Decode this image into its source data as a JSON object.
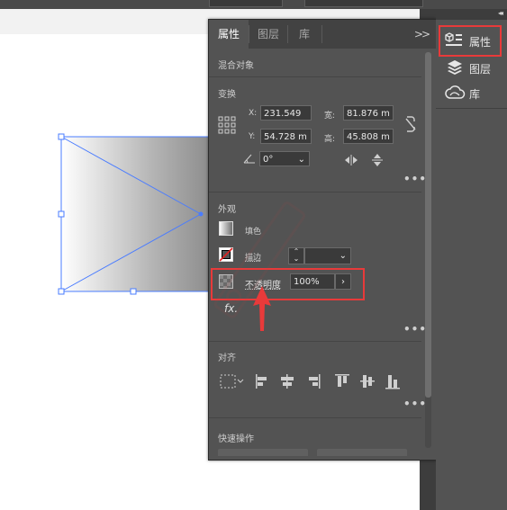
{
  "panel": {
    "tabs": [
      "属性",
      "图层",
      "库"
    ],
    "active_tab": "属性",
    "object_type": "混合对象",
    "transform": {
      "title": "变换",
      "x_label": "X:",
      "x_value": "231.549",
      "y_label": "Y:",
      "y_value": "54.728 m",
      "w_label": "宽:",
      "w_value": "81.876 m",
      "h_label": "高:",
      "h_value": "45.808 m",
      "angle_value": "0°"
    },
    "appearance": {
      "title": "外观",
      "fill_label": "填色",
      "stroke_label": "描边",
      "opacity_label": "不透明度",
      "opacity_value": "100%",
      "fx_label": "fx."
    },
    "align": {
      "title": "对齐"
    },
    "quick_actions": {
      "title": "快速操作"
    }
  },
  "dock": {
    "items": [
      {
        "label": "属性",
        "icon": "properties-icon",
        "selected": true
      },
      {
        "label": "图层",
        "icon": "layers-icon",
        "selected": false
      },
      {
        "label": "库",
        "icon": "libraries-icon",
        "selected": false
      }
    ]
  },
  "colors": {
    "highlight": "#e83a3a",
    "selection": "#4a7cff",
    "panel_bg": "#535353"
  }
}
